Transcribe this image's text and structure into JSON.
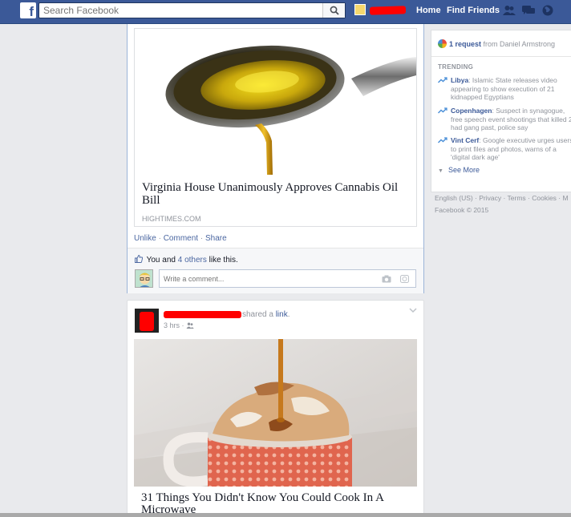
{
  "topbar": {
    "search_placeholder": "Search Facebook",
    "home": "Home",
    "find_friends": "Find Friends"
  },
  "post1": {
    "link_title": "Virginia House Unanimously Approves Cannabis Oil Bill",
    "link_source": "HIGHTIMES.COM",
    "actions": {
      "unlike": "Unlike",
      "comment": "Comment",
      "share": "Share",
      "sep": "·"
    },
    "likes": {
      "prefix": "You and ",
      "others": "4 others",
      "suffix": " like this."
    },
    "comment_placeholder": "Write a comment..."
  },
  "post2": {
    "shared_prefix": "shared a ",
    "shared_link": "link",
    "shared_suffix": ".",
    "time": "3 hrs",
    "link_title": "31 Things You Didn't Know You Could Cook In A Microwave"
  },
  "sidebar": {
    "request_count": "1 request",
    "request_from": " from Daniel Armstrong",
    "trending_heading": "TRENDING",
    "trends": [
      {
        "topic": "Libya",
        "text": ": Islamic State releases video appearing to show execution of 21 kidnapped Egyptians"
      },
      {
        "topic": "Copenhagen",
        "text": ": Suspect in synagogue, free speech event shootings that killed 2 had gang past, police say"
      },
      {
        "topic": "Vint Cerf",
        "text": ": Google executive urges users to print files and photos, warns of a 'digital dark age'"
      }
    ],
    "see_more": "See More"
  },
  "footer": {
    "line1": "English (US) · Privacy · Terms · Cookies · M",
    "line2": "Facebook © 2015"
  },
  "colors": {
    "topbar": "#3b5998",
    "link": "#4b67a1",
    "redaction": "#ff0000"
  }
}
